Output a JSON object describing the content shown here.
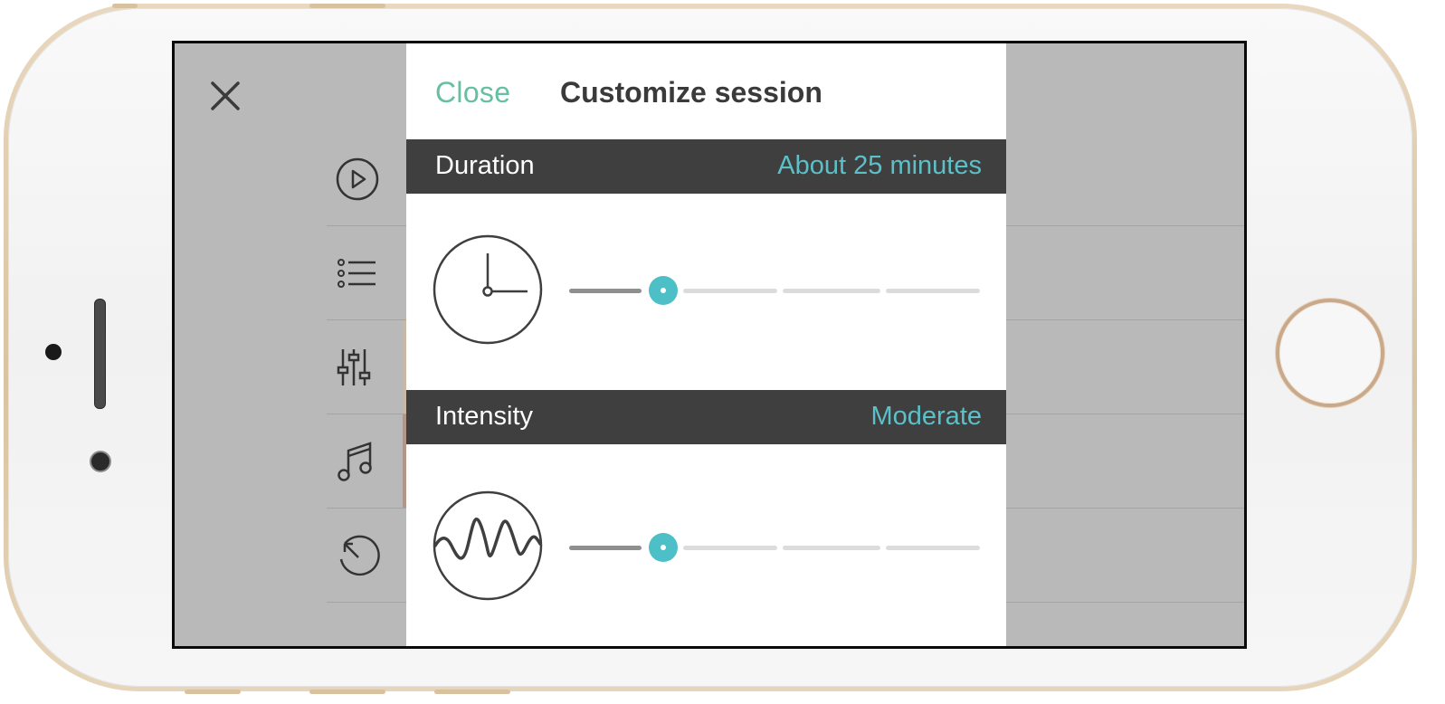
{
  "modal": {
    "close_label": "Close",
    "title": "Customize session"
  },
  "duration": {
    "label": "Duration",
    "value": "About 25 minutes",
    "slider_level": 1,
    "slider_steps": 5
  },
  "intensity": {
    "label": "Intensity",
    "value": "Moderate",
    "slider_level": 1,
    "slider_steps": 5
  },
  "background_menu": {
    "items": [
      {
        "icon": "play-icon"
      },
      {
        "icon": "list-icon"
      },
      {
        "icon": "sliders-icon"
      },
      {
        "icon": "music-icon"
      },
      {
        "icon": "history-icon"
      }
    ]
  },
  "icons": {
    "close": "close-icon",
    "duration": "clock-icon",
    "intensity": "wave-icon"
  },
  "colors": {
    "accent_teal": "#5cc0c8",
    "close_green": "#66c0a0",
    "section_bar": "#3f3f3f",
    "overlay_gray": "#b9b9b9"
  }
}
